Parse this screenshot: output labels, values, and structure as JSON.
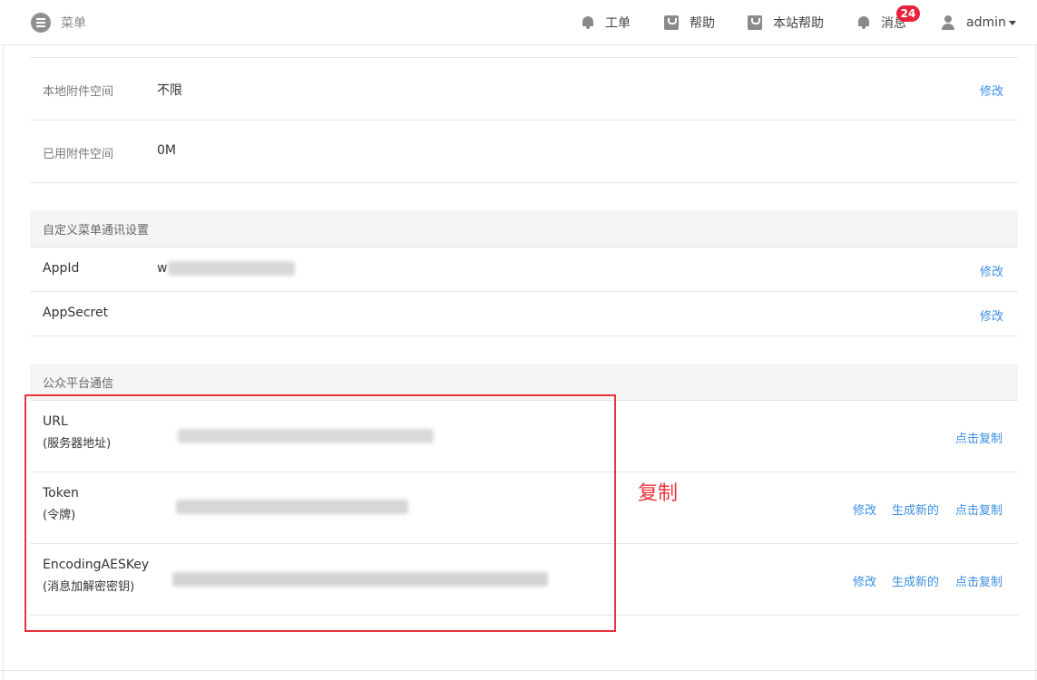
{
  "header": {
    "menu_label": "菜单",
    "nav": [
      {
        "label": "工单",
        "icon": "bell-icon"
      },
      {
        "label": "帮助",
        "icon": "bag-icon"
      },
      {
        "label": "本站帮助",
        "icon": "bag-icon"
      },
      {
        "label": "消息",
        "icon": "bell-icon"
      }
    ],
    "message_badge": "24",
    "user": "admin"
  },
  "storage": {
    "local_label": "本地附件空间",
    "local_value": "不限",
    "local_action": "修改",
    "used_label": "已用附件空间",
    "used_value": "0M"
  },
  "custom_menu": {
    "title": "自定义菜单通讯设置",
    "appid_label": "AppId",
    "appid_value": "w",
    "appid_action": "修改",
    "appsecret_label": "AppSecret",
    "appsecret_action": "修改"
  },
  "platform": {
    "title": "公众平台通信",
    "url_label": "URL",
    "url_sub": "(服务器地址)",
    "url_action": "点击复制",
    "token_label": "Token",
    "token_sub": "(令牌)",
    "token_edit": "修改",
    "token_generate": "生成新的",
    "token_copy": "点击复制",
    "aes_label": "EncodingAESKey",
    "aes_sub": "(消息加解密密钥)",
    "aes_edit": "修改",
    "aes_generate": "生成新的",
    "aes_copy": "点击复制"
  },
  "annotation": {
    "note": "复制",
    "color": "#e8343a"
  },
  "colors": {
    "link": "#3a8ee6",
    "badge": "#e8203a"
  }
}
